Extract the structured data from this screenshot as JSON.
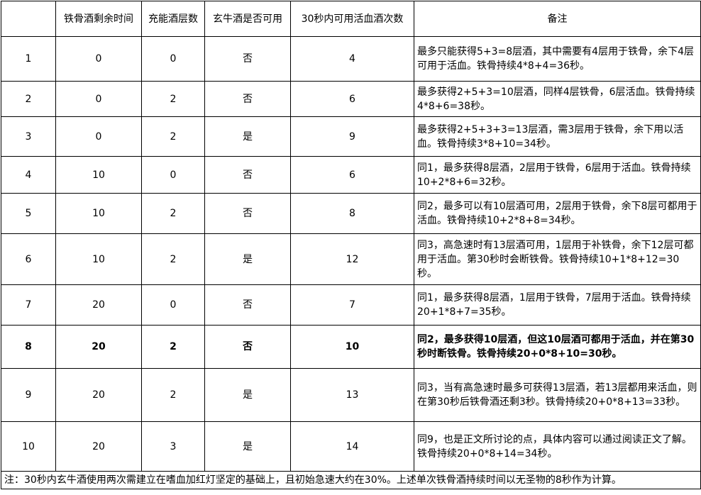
{
  "headers": [
    "",
    "铁骨酒剩余时间",
    "充能酒层数",
    "玄牛酒是否可用",
    "30秒内可用活血酒次数",
    "备注"
  ],
  "rows": [
    {
      "n": "1",
      "t": "0",
      "c": "0",
      "x": "否",
      "k": "4",
      "note": "最多只能获得5+3=8层酒，其中需要有4层用于铁骨，余下4层可用于活血。铁骨持续4*8+4=36秒。"
    },
    {
      "n": "2",
      "t": "0",
      "c": "2",
      "x": "否",
      "k": "6",
      "note": "最多获得2+5+3=10层酒，同样4层铁骨，6层活血。铁骨持续4*8+6=38秒。"
    },
    {
      "n": "3",
      "t": "0",
      "c": "2",
      "x": "是",
      "k": "9",
      "note": "最多获得2+5+3+3=13层酒，需3层用于铁骨，余下用以活血。铁骨持续3*8+10=34秒。"
    },
    {
      "n": "4",
      "t": "10",
      "c": "0",
      "x": "否",
      "k": "6",
      "note": "同1，最多获得8层酒，2层用于铁骨，6层用于活血。铁骨持续10+2*8+6=32秒。"
    },
    {
      "n": "5",
      "t": "10",
      "c": "2",
      "x": "否",
      "k": "8",
      "note": "同2，最多可以有10层酒可用，2层用于铁骨，余下8层可都用于活血。铁骨持续10+2*8+8=34秒。"
    },
    {
      "n": "6",
      "t": "10",
      "c": "2",
      "x": "是",
      "k": "12",
      "note": "同3，高急速时有13层酒可用，1层用于补铁骨，余下12层可都用于活血。第30秒时会断铁骨。铁骨持续10+1*8+12=30秒。"
    },
    {
      "n": "7",
      "t": "20",
      "c": "0",
      "x": "否",
      "k": "7",
      "note": "同1，最多获得8层酒，1层用于铁骨，7层用于活血。铁骨持续20+1*8+7=35秒。"
    },
    {
      "n": "8",
      "t": "20",
      "c": "2",
      "x": "否",
      "k": "10",
      "note": "同2，最多获得10层酒，但这10层酒可都用于活血，并在第30秒时断铁骨。铁骨持续20+0*8+10=30秒。"
    },
    {
      "n": "9",
      "t": "20",
      "c": "2",
      "x": "是",
      "k": "13",
      "note": "同3，当有高急速时最多可获得13层酒，若13层都用来活血，则在第30秒后铁骨酒还剩3秒。铁骨持续20+0*8+13=33秒。"
    },
    {
      "n": "10",
      "t": "20",
      "c": "3",
      "x": "是",
      "k": "14",
      "note": "同9，也是正文所讨论的点，具体内容可以通过阅读正文了解。铁骨持续20+0*8+14=34秒。"
    }
  ],
  "footer": "注：30秒内玄牛酒使用两次需建立在嗜血加红灯坚定的基础上，且初始急速大约在30%。上述单次铁骨酒持续时间以无圣物的8秒作为计算。"
}
